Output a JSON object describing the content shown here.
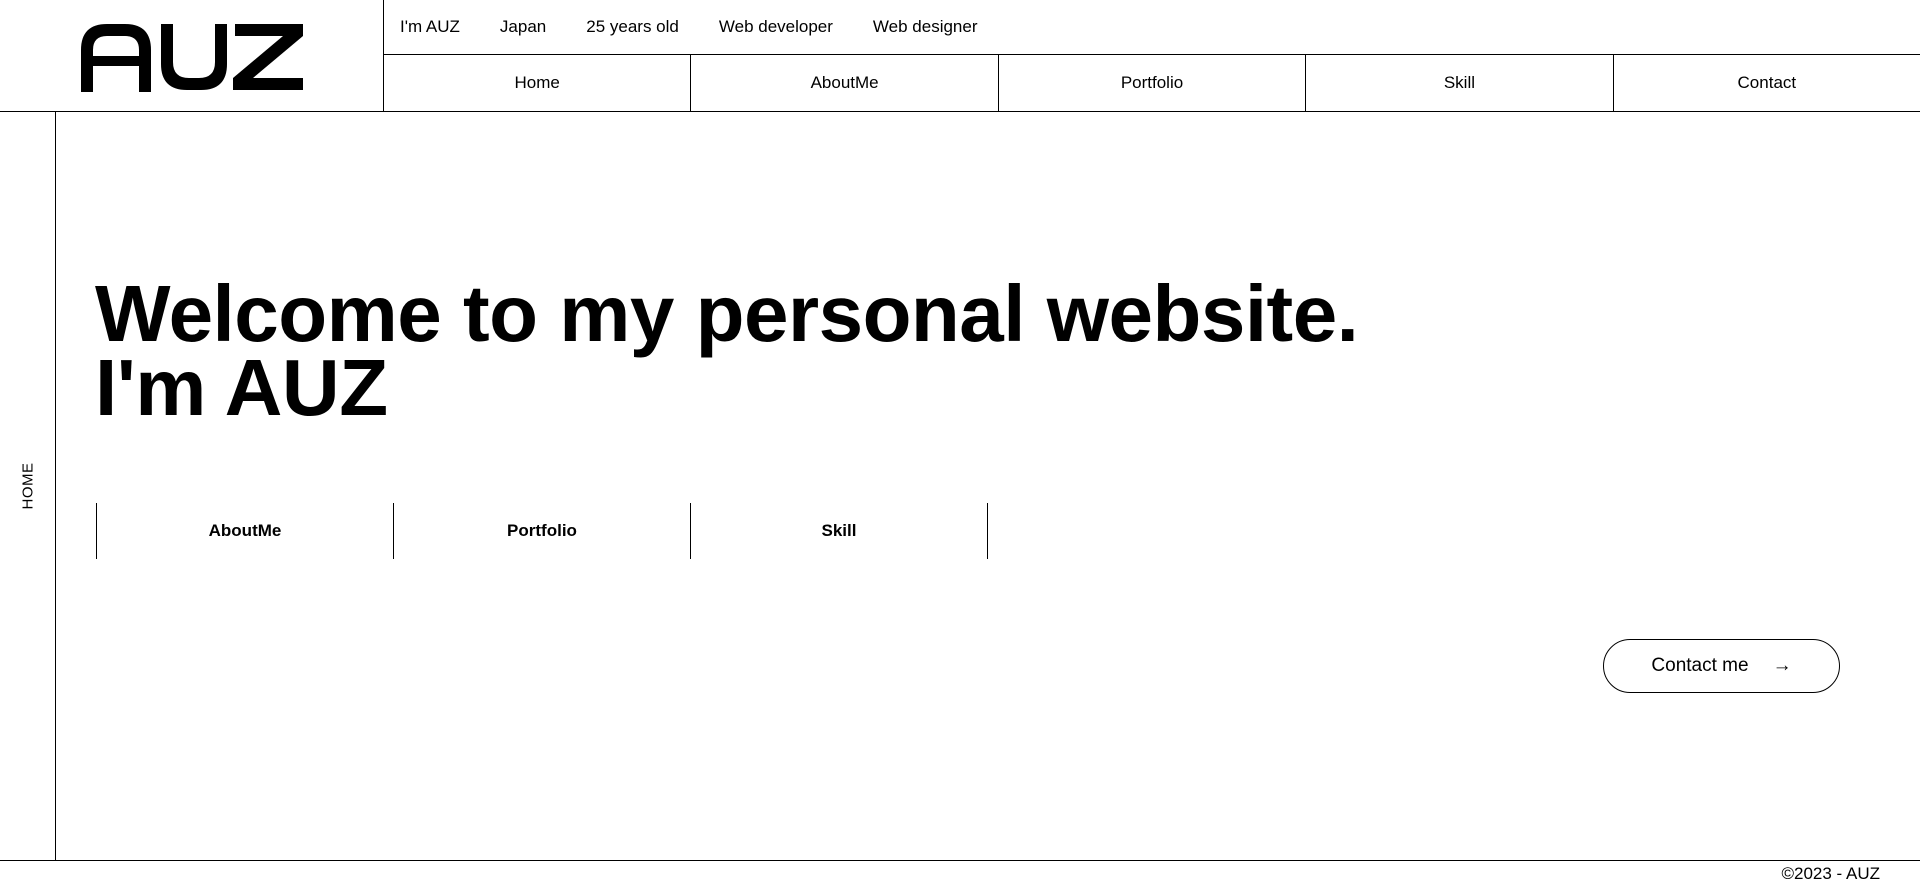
{
  "brand": {
    "logo_text": "AUZ"
  },
  "tagline": [
    "I'm AUZ",
    "Japan",
    "25 years old",
    "Web developer",
    "Web designer"
  ],
  "nav": [
    "Home",
    "AboutMe",
    "Portfolio",
    "Skill",
    "Contact"
  ],
  "rail": {
    "label": "HOME"
  },
  "hero": {
    "line1": "Welcome to my personal website.",
    "line2": "I'm AUZ"
  },
  "quick_links": [
    "AboutMe",
    "Portfolio",
    "Skill"
  ],
  "cta": {
    "label": "Contact me",
    "arrow": "→"
  },
  "footer": {
    "copyright": "©2023 - AUZ"
  },
  "colors": {
    "foreground": "#000000",
    "background": "#ffffff"
  }
}
